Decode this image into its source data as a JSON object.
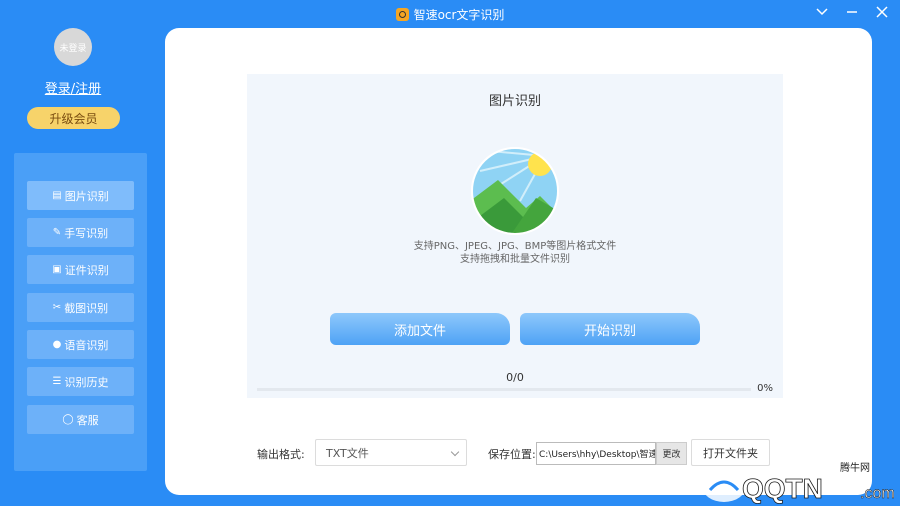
{
  "window": {
    "title": "智速ocr文字识别",
    "controls": [
      "minimize-icon",
      "maximize-icon",
      "close-icon"
    ]
  },
  "sidebar": {
    "avatar_text": "未登录",
    "login_label": "登录/注册",
    "upgrade_label": "升级会员",
    "items": [
      {
        "label": "图片识别",
        "icon": "image-icon"
      },
      {
        "label": "手写识别",
        "icon": "pen-icon"
      },
      {
        "label": "证件识别",
        "icon": "id-card-icon"
      },
      {
        "label": "截图识别",
        "icon": "screenshot-icon"
      },
      {
        "label": "语音识别",
        "icon": "microphone-icon"
      },
      {
        "label": "识别历史",
        "icon": "history-icon"
      },
      {
        "label": "客服",
        "icon": "headset-icon"
      }
    ]
  },
  "main": {
    "title": "图片识别",
    "support_line1": "支持PNG、JPEG、JPG、BMP等图片格式文件",
    "support_line2": "支持拖拽和批量文件识别",
    "add_label": "添加文件",
    "start_label": "开始识别",
    "progress_count": "0/0",
    "progress_pct": "0%",
    "progress_value": 0
  },
  "options": {
    "format_label": "输出格式:",
    "format_value": "TXT文件",
    "save_label": "保存位置:",
    "save_path": "C:\\Users\\hhy\\Desktop\\智速o",
    "change_label": "更改",
    "open_folder_label": "打开文件夹"
  },
  "watermark": {
    "brand_cn": "腾牛网",
    "brand_en": "QQTN",
    "suffix": ".com"
  },
  "colors": {
    "accent": "#2a8cf5",
    "nav_panel": "#4a9ff7",
    "nav_item": "#6db1f9",
    "upgrade": "#f7d36a",
    "button_gradient_top": "#8ec8fb",
    "button_gradient_bottom": "#4ea2f5"
  }
}
